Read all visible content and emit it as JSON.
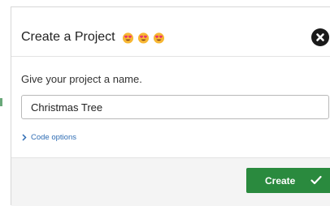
{
  "modal": {
    "title": "Create a Project",
    "title_emojis": [
      "heart-eyes-emoji",
      "heart-eyes-emoji",
      "heart-eyes-emoji"
    ],
    "close_icon": "close-icon",
    "prompt_label": "Give your project a name.",
    "name_input": {
      "value": "Christmas Tree",
      "placeholder": ""
    },
    "code_options_label": "Code options",
    "create_button_label": "Create",
    "colors": {
      "create_button": "#2a8a3e",
      "link": "#2f6db4",
      "footer_background": "#f4f4f4",
      "close_button": "#1a1a1a"
    }
  }
}
